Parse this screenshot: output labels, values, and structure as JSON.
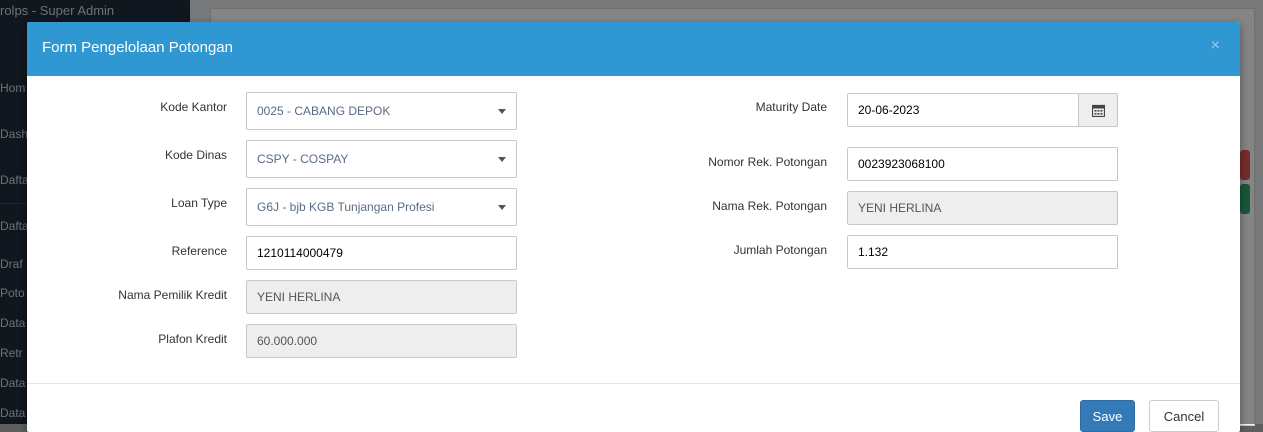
{
  "background": {
    "app_title": "rolps - Super Admin",
    "nav_items": [
      "Hom",
      "Dash",
      "Dafta",
      "Dafta",
      "Draf",
      "Poto",
      "Data",
      "Retr",
      "Data",
      "Data"
    ]
  },
  "modal": {
    "title": "Form Pengelolaan Potongan",
    "close_icon": "×",
    "left": {
      "kode_kantor": {
        "label": "Kode Kantor",
        "value": "0025 - CABANG DEPOK"
      },
      "kode_dinas": {
        "label": "Kode Dinas",
        "value": "CSPY - COSPAY"
      },
      "loan_type": {
        "label": "Loan Type",
        "value": "G6J - bjb KGB Tunjangan Profesi"
      },
      "reference": {
        "label": "Reference",
        "value": "1210114000479"
      },
      "nama_pemilik": {
        "label": "Nama Pemilik Kredit",
        "value": "YENI HERLINA"
      },
      "plafon": {
        "label": "Plafon Kredit",
        "value": "60.000.000"
      }
    },
    "right": {
      "maturity_date": {
        "label": "Maturity Date",
        "value": "20-06-2023"
      },
      "nomor_rek": {
        "label": "Nomor Rek. Potongan",
        "value": "0023923068100"
      },
      "nama_rek": {
        "label": "Nama Rek. Potongan",
        "value": "YENI HERLINA"
      },
      "jumlah": {
        "label": "Jumlah Potongan",
        "value": "1.132"
      }
    },
    "footer": {
      "save_label": "Save",
      "cancel_label": "Cancel"
    }
  },
  "colors": {
    "header": "#2f97d1",
    "save_button": "#337ab7"
  }
}
